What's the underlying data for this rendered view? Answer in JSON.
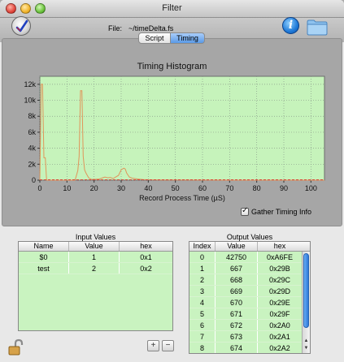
{
  "window": {
    "title": "Filter"
  },
  "toolbar": {
    "file_label": "File:",
    "file_path": "~/timeDelta.fs",
    "tabs": [
      {
        "label": "Script",
        "selected": false
      },
      {
        "label": "Timing",
        "selected": true
      }
    ],
    "icons": {
      "app": "checkmark-app-icon",
      "info": "info-icon",
      "folder": "folder-icon"
    }
  },
  "chart_data": {
    "type": "line",
    "title": "Timing Histogram",
    "xlabel": "Record Process Time (µS)",
    "ylabel": "",
    "xlim": [
      0,
      105
    ],
    "ylim": [
      0,
      13000
    ],
    "xticks": [
      0,
      10,
      20,
      30,
      40,
      50,
      60,
      70,
      80,
      90,
      100
    ],
    "xtick_labels": [
      "0",
      "10",
      "20",
      "30",
      "40",
      "50",
      "60",
      "70",
      "80",
      "90",
      "100"
    ],
    "yticks": [
      0,
      2000,
      4000,
      6000,
      8000,
      10000,
      12000
    ],
    "ytick_labels": [
      "0",
      "2k",
      "4k",
      "6k",
      "8k",
      "10k",
      "12k"
    ],
    "grid": true,
    "background": "#c6f3bb",
    "series": [
      {
        "color": "#e0955a",
        "x": [
          0,
          0.5,
          1,
          1.5,
          2,
          2.5,
          3,
          13,
          14,
          14.5,
          15,
          15.5,
          16,
          16.5,
          17,
          18,
          19,
          20,
          22,
          24,
          25,
          26,
          27,
          28,
          29,
          30,
          31,
          31.5,
          32,
          33,
          34,
          36,
          38,
          40,
          45,
          50,
          60,
          70,
          80,
          90,
          100,
          105
        ],
        "y": [
          0,
          12000,
          12000,
          2800,
          2800,
          0,
          0,
          0,
          1200,
          3000,
          11200,
          11200,
          3000,
          1300,
          900,
          300,
          100,
          100,
          150,
          400,
          300,
          350,
          200,
          400,
          600,
          1300,
          1500,
          1400,
          900,
          400,
          250,
          150,
          80,
          50,
          30,
          20,
          10,
          5,
          3,
          2,
          1,
          0
        ]
      }
    ]
  },
  "gather_timing": {
    "label": "Gather Timing Info",
    "checked": true
  },
  "input_values": {
    "caption": "Input Values",
    "columns": [
      "Name",
      "Value",
      "hex"
    ],
    "rows": [
      [
        "$0",
        "1",
        "0x1"
      ],
      [
        "test",
        "2",
        "0x2"
      ]
    ]
  },
  "output_values": {
    "caption": "Output Values",
    "columns": [
      "Index",
      "Value",
      "hex"
    ],
    "rows": [
      [
        "0",
        "42750",
        "0xA6FE"
      ],
      [
        "1",
        "667",
        "0x29B"
      ],
      [
        "2",
        "668",
        "0x29C"
      ],
      [
        "3",
        "669",
        "0x29D"
      ],
      [
        "4",
        "670",
        "0x29E"
      ],
      [
        "5",
        "671",
        "0x29F"
      ],
      [
        "6",
        "672",
        "0x2A0"
      ],
      [
        "7",
        "673",
        "0x2A1"
      ],
      [
        "8",
        "674",
        "0x2A2"
      ]
    ]
  },
  "buttons": {
    "add_label": "+",
    "remove_label": "−"
  },
  "icons": {
    "lock": "unlocked-padlock-icon"
  }
}
